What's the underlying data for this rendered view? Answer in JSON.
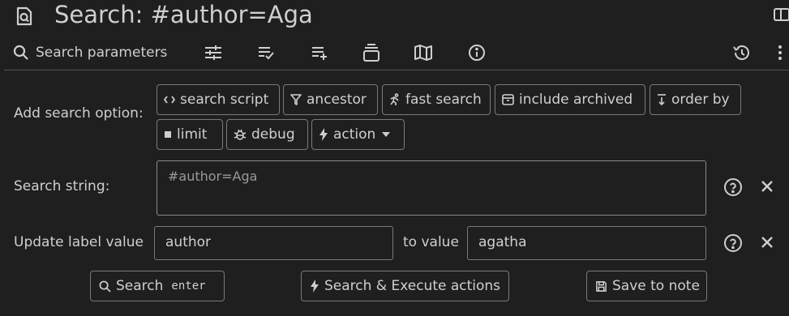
{
  "title": "Search: #author=Aga",
  "toolbar": {
    "search_params_label": "Search parameters",
    "icons": [
      "tune-icon",
      "list-check-icon",
      "playlist-add-icon",
      "stack-icon",
      "map-icon",
      "info-icon",
      "history-icon",
      "more-vertical-icon"
    ]
  },
  "options": {
    "label": "Add search option:",
    "buttons": [
      {
        "label": "search script",
        "icon": "code-icon"
      },
      {
        "label": "ancestor",
        "icon": "filter-icon"
      },
      {
        "label": "fast search",
        "icon": "running-icon"
      },
      {
        "label": "include archived",
        "icon": "archive-icon"
      },
      {
        "label": "order by",
        "icon": "sort-down-icon"
      },
      {
        "label": "limit",
        "icon": "square-icon"
      },
      {
        "label": "debug",
        "icon": "bug-icon"
      },
      {
        "label": "action",
        "icon": "bolt-icon"
      }
    ]
  },
  "search_string": {
    "label": "Search string:",
    "value": "#author=Aga"
  },
  "update_label": {
    "label": "Update label value",
    "name_value": "author",
    "to_value_label": "to value",
    "new_value": "agatha"
  },
  "actions": {
    "search": "Search",
    "search_shortcut": "enter",
    "search_execute": "Search & Execute actions",
    "save_to_note": "Save to note"
  }
}
